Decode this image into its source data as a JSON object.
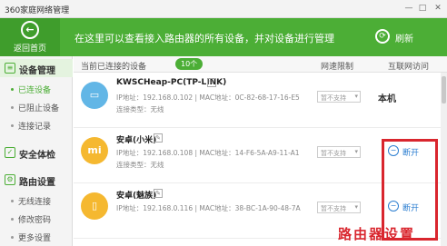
{
  "window": {
    "title": "360家庭网络管理",
    "min_glyph": "—",
    "max_glyph": "□",
    "close_glyph": "✕"
  },
  "banner": {
    "back_label": "返回首页",
    "back_glyph": "←",
    "text": "在这里可以查看接入路由器的所有设备，并对设备进行管理",
    "refresh_label": "刷新",
    "refresh_glyph": "⟳",
    "color": "#4cae36"
  },
  "sidebar": {
    "groups": [
      {
        "label": "设备管理",
        "icon": "list-icon",
        "glyph": "≡",
        "items": [
          {
            "label": "已连设备",
            "active": true
          },
          {
            "label": "已阻止设备",
            "active": false
          },
          {
            "label": "连接记录",
            "active": false
          }
        ]
      },
      {
        "label": "安全体检",
        "icon": "shield-icon",
        "glyph": "✓",
        "items": []
      },
      {
        "label": "路由设置",
        "icon": "gear-icon",
        "glyph": "⚙",
        "items": [
          {
            "label": "无线连接",
            "active": false
          },
          {
            "label": "修改密码",
            "active": false
          },
          {
            "label": "更多设置",
            "active": false
          }
        ]
      }
    ]
  },
  "table": {
    "headers": {
      "device": "当前已连接的设备",
      "count": "10个",
      "speed": "网速限制",
      "internet": "互联网访问"
    },
    "rows": [
      {
        "name": "KWSCHeap-PC(TP-LINK)",
        "icon": "monitor-icon",
        "info": "IP地址：192.168.0.102 | MAC地址：0C-82-68-17-16-E5",
        "type": "连接类型：无线",
        "speed": "暂不支持",
        "access": "本机"
      },
      {
        "name": "安卓(小米)",
        "icon": "phone-icon",
        "info": "IP地址：192.168.0.108 | MAC地址：14-F6-5A-A9-11-A1",
        "type": "连接类型：无线",
        "speed": "暂不支持",
        "access": "断开"
      },
      {
        "name": "安卓(魅族)",
        "icon": "phone-icon",
        "info": "IP地址：192.168.0.116 | MAC地址：38-BC-1A-90-48-7A",
        "type": "",
        "speed": "暂不支持",
        "access": "断开"
      }
    ]
  },
  "watermark": "路由器设置",
  "colors": {
    "accent": "#4cae36",
    "link": "#2d7fd1",
    "highlight": "#d9262e"
  }
}
